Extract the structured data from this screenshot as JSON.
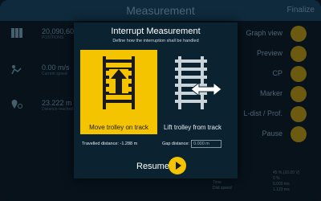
{
  "background": {
    "title": "Measurement",
    "finalize_label": "Finalize",
    "metrics": [
      {
        "value": "20,090,605",
        "sub": "POSITIONS",
        "icon": "positions-icon"
      },
      {
        "value": "0.00 m/s",
        "sub": "Current speed",
        "icon": "speed-icon"
      },
      {
        "value": "23.222 m",
        "sub": "Distance reached",
        "icon": "location-icon"
      }
    ],
    "side_menu": [
      {
        "label": "Graph view",
        "icon": "graph-icon"
      },
      {
        "label": "Preview",
        "icon": "preview-icon"
      },
      {
        "label": "CP",
        "icon": "cp-icon"
      },
      {
        "label": "Marker",
        "icon": "marker-icon"
      },
      {
        "label": "L-dist / Prof.",
        "icon": "profile-icon"
      },
      {
        "label": "Pause",
        "icon": "pause-icon"
      }
    ],
    "info_lines": [
      "45 % (10.00 V)",
      "0 %",
      "0.000 ms",
      "1.123 ms"
    ],
    "bottom_lines": [
      "Time",
      "Dist speed"
    ]
  },
  "dialog": {
    "title": "Interrupt Measurement",
    "subtitle": "Define how the interruption shall be handled",
    "option_move": "Move trolley on track",
    "option_lift": "Lift trolley from track",
    "travelled_label": "Travelled distance: -1.288 m",
    "gap_label": "Gap distance:",
    "gap_value": "0.000 m",
    "resume_label": "Resume"
  },
  "colors": {
    "accent": "#f5c400",
    "dialog_bg": "#0b2230"
  }
}
